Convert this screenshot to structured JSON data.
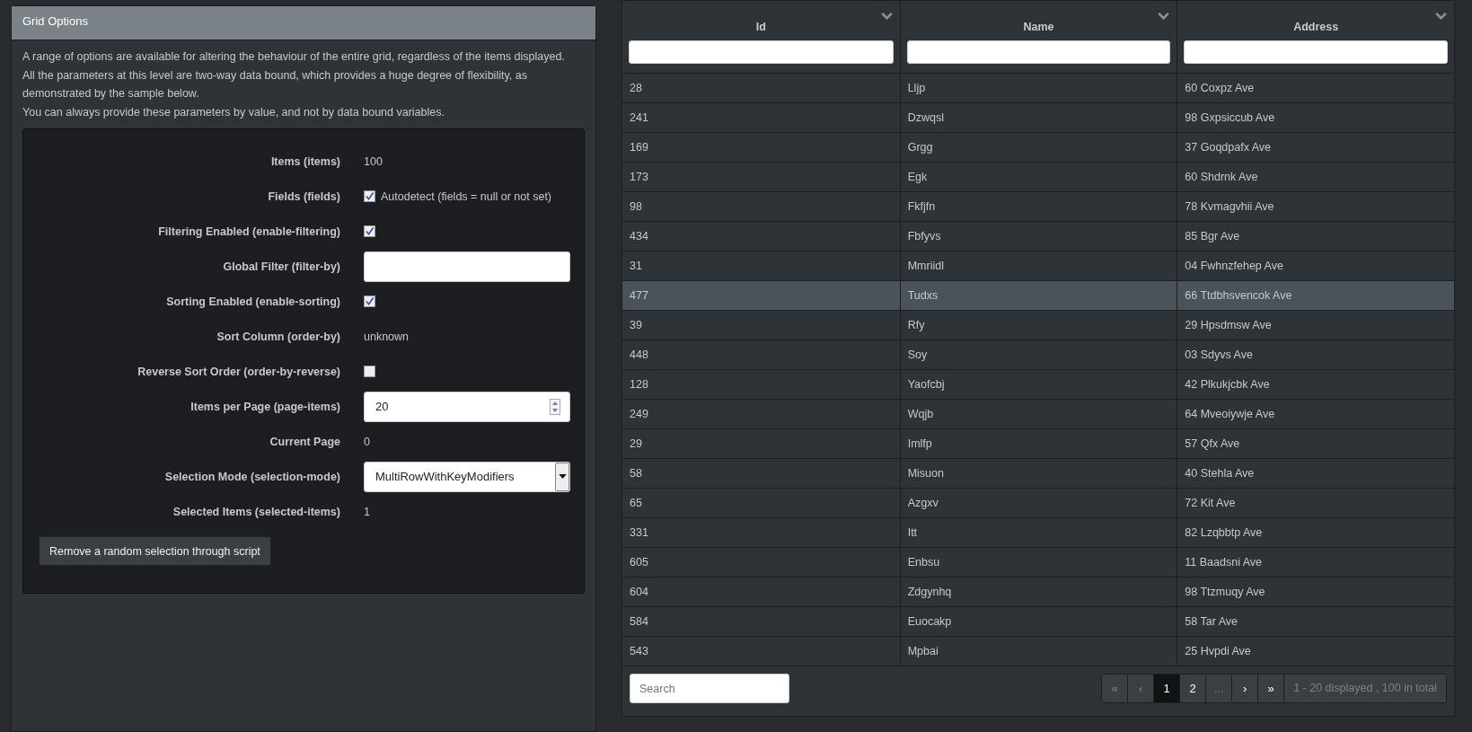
{
  "panel": {
    "title": "Grid Options",
    "description": [
      "A range of options are available for altering the behaviour of the entire grid, regardless of the items displayed.",
      "All the parameters at this level are two-way data bound, which provides a huge degree of flexibility, as demonstrated by the sample below.",
      "You can always provide these parameters by value, and not by data bound variables."
    ]
  },
  "options": [
    {
      "kind": "text",
      "label": "Items (items)",
      "value": "100"
    },
    {
      "kind": "checkbox",
      "label": "Fields (fields)",
      "checked": true,
      "note": "Autodetect (fields = null or not set)"
    },
    {
      "kind": "checkbox",
      "label": "Filtering Enabled (enable-filtering)",
      "checked": true
    },
    {
      "kind": "input",
      "label": "Global Filter (filter-by)"
    },
    {
      "kind": "checkbox",
      "label": "Sorting Enabled (enable-sorting)",
      "checked": true
    },
    {
      "kind": "text",
      "label": "Sort Column (order-by)",
      "value": "unknown"
    },
    {
      "kind": "checkbox",
      "label": "Reverse Sort Order (order-by-reverse)",
      "checked": false
    },
    {
      "kind": "number",
      "label": "Items per Page (page-items)",
      "value": "20"
    },
    {
      "kind": "text",
      "label": "Current Page",
      "value": "0"
    },
    {
      "kind": "select",
      "label": "Selection Mode (selection-mode)",
      "value": "MultiRowWithKeyModifiers"
    },
    {
      "kind": "text",
      "label": "Selected Items (selected-items)",
      "value": "1"
    }
  ],
  "action_button": "Remove a random selection through script",
  "table": {
    "columns": [
      "Id",
      "Name",
      "Address"
    ],
    "rows": [
      {
        "cells": [
          "28",
          "Lljp",
          "60 Coxpz Ave"
        ],
        "selected": false
      },
      {
        "cells": [
          "241",
          "Dzwqsl",
          "98 Gxpsiccub Ave"
        ],
        "selected": false
      },
      {
        "cells": [
          "169",
          "Grgg",
          "37 Goqdpafx Ave"
        ],
        "selected": false
      },
      {
        "cells": [
          "173",
          "Egk",
          "60 Shdrnk Ave"
        ],
        "selected": false
      },
      {
        "cells": [
          "98",
          "Fkfjfn",
          "78 Kvmagvhii Ave"
        ],
        "selected": false
      },
      {
        "cells": [
          "434",
          "Fbfyvs",
          "85 Bgr Ave"
        ],
        "selected": false
      },
      {
        "cells": [
          "31",
          "Mmriidl",
          "04 Fwhnzfehep Ave"
        ],
        "selected": false
      },
      {
        "cells": [
          "477",
          "Tudxs",
          "66 Ttdbhsvencok Ave"
        ],
        "selected": true
      },
      {
        "cells": [
          "39",
          "Rfy",
          "29 Hpsdmsw Ave"
        ],
        "selected": false
      },
      {
        "cells": [
          "448",
          "Soy",
          "03 Sdyvs Ave"
        ],
        "selected": false
      },
      {
        "cells": [
          "128",
          "Yaofcbj",
          "42 Plkukjcbk Ave"
        ],
        "selected": false
      },
      {
        "cells": [
          "249",
          "Wqjb",
          "64 Mveoiywje Ave"
        ],
        "selected": false
      },
      {
        "cells": [
          "29",
          "Imlfp",
          "57 Qfx Ave"
        ],
        "selected": false
      },
      {
        "cells": [
          "58",
          "Misuon",
          "40 Stehla Ave"
        ],
        "selected": false
      },
      {
        "cells": [
          "65",
          "Azgxv",
          "72 Kit Ave"
        ],
        "selected": false
      },
      {
        "cells": [
          "331",
          "Itt",
          "82 Lzqbbtp Ave"
        ],
        "selected": false
      },
      {
        "cells": [
          "605",
          "Enbsu",
          "11 Baadsni Ave"
        ],
        "selected": false
      },
      {
        "cells": [
          "604",
          "Zdgynhq",
          "98 Ttzmuqy Ave"
        ],
        "selected": false
      },
      {
        "cells": [
          "584",
          "Euocakp",
          "58 Tar Ave"
        ],
        "selected": false
      },
      {
        "cells": [
          "543",
          "Mpbai",
          "25 Hvpdi Ave"
        ],
        "selected": false
      }
    ],
    "search_placeholder": "Search",
    "pagination": [
      {
        "label": "«",
        "selected": false,
        "disabled": true
      },
      {
        "label": "‹",
        "selected": false,
        "disabled": true
      },
      {
        "label": "1",
        "selected": true,
        "disabled": false
      },
      {
        "label": "2",
        "selected": false,
        "disabled": false
      },
      {
        "label": "...",
        "selected": false,
        "disabled": true
      },
      {
        "label": "›",
        "selected": false,
        "disabled": false
      },
      {
        "label": "»",
        "selected": false,
        "disabled": false
      }
    ],
    "summary": "1 - 20 displayed , 100 in total"
  }
}
